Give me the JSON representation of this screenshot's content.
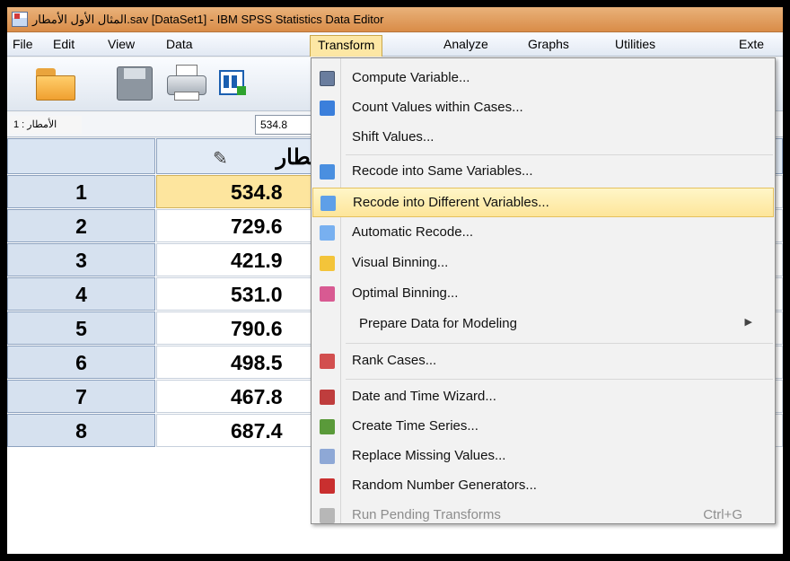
{
  "window": {
    "title": "المثال الأول الأمطار.sav [DataSet1] - IBM SPSS Statistics Data Editor"
  },
  "menubar": {
    "items": [
      "File",
      "Edit",
      "View",
      "Data",
      "Transform",
      "Analyze",
      "Graphs",
      "Utilities",
      "Exte"
    ],
    "active": "Transform"
  },
  "toolbar": {
    "icons": [
      "folder-open-icon",
      "save-icon",
      "printer-icon",
      "dialog-recall-icon"
    ]
  },
  "refbar": {
    "cell_ref": "1 : الأمطار",
    "cell_value": "534.8"
  },
  "grid": {
    "column_header": "مطار",
    "rows": [
      {
        "num": "1",
        "value": "534.8"
      },
      {
        "num": "2",
        "value": "729.6"
      },
      {
        "num": "3",
        "value": "421.9"
      },
      {
        "num": "4",
        "value": "531.0"
      },
      {
        "num": "5",
        "value": "790.6"
      },
      {
        "num": "6",
        "value": "498.5"
      },
      {
        "num": "7",
        "value": "467.8"
      },
      {
        "num": "8",
        "value": "687.4"
      }
    ]
  },
  "transform_menu": {
    "items": [
      {
        "label": "Compute Variable...",
        "icon": "compute-icon"
      },
      {
        "label": "Count Values within Cases...",
        "icon": "count-icon"
      },
      {
        "label": "Shift Values...",
        "icon": ""
      },
      {
        "label": "Recode into Same Variables...",
        "icon": "recode-same-icon"
      },
      {
        "label": "Recode into Different Variables...",
        "icon": "recode-different-icon",
        "highlighted": true
      },
      {
        "label": "Automatic Recode...",
        "icon": "automatic-recode-icon"
      },
      {
        "label": "Visual Binning...",
        "icon": "visual-binning-icon"
      },
      {
        "label": "Optimal Binning...",
        "icon": "optimal-binning-icon"
      },
      {
        "label": "Prepare Data for Modeling",
        "icon": "",
        "submenu": true
      },
      {
        "label": "Rank Cases...",
        "icon": "rank-icon"
      },
      {
        "label": "Date and Time Wizard...",
        "icon": "calendar-icon"
      },
      {
        "label": "Create Time Series...",
        "icon": "time-series-icon"
      },
      {
        "label": "Replace Missing Values...",
        "icon": "replace-missing-icon"
      },
      {
        "label": "Random Number Generators...",
        "icon": "dice-icon"
      },
      {
        "label": "Run Pending Transforms",
        "icon": "run-pending-icon",
        "shortcut": "Ctrl+G",
        "disabled": true
      }
    ]
  }
}
